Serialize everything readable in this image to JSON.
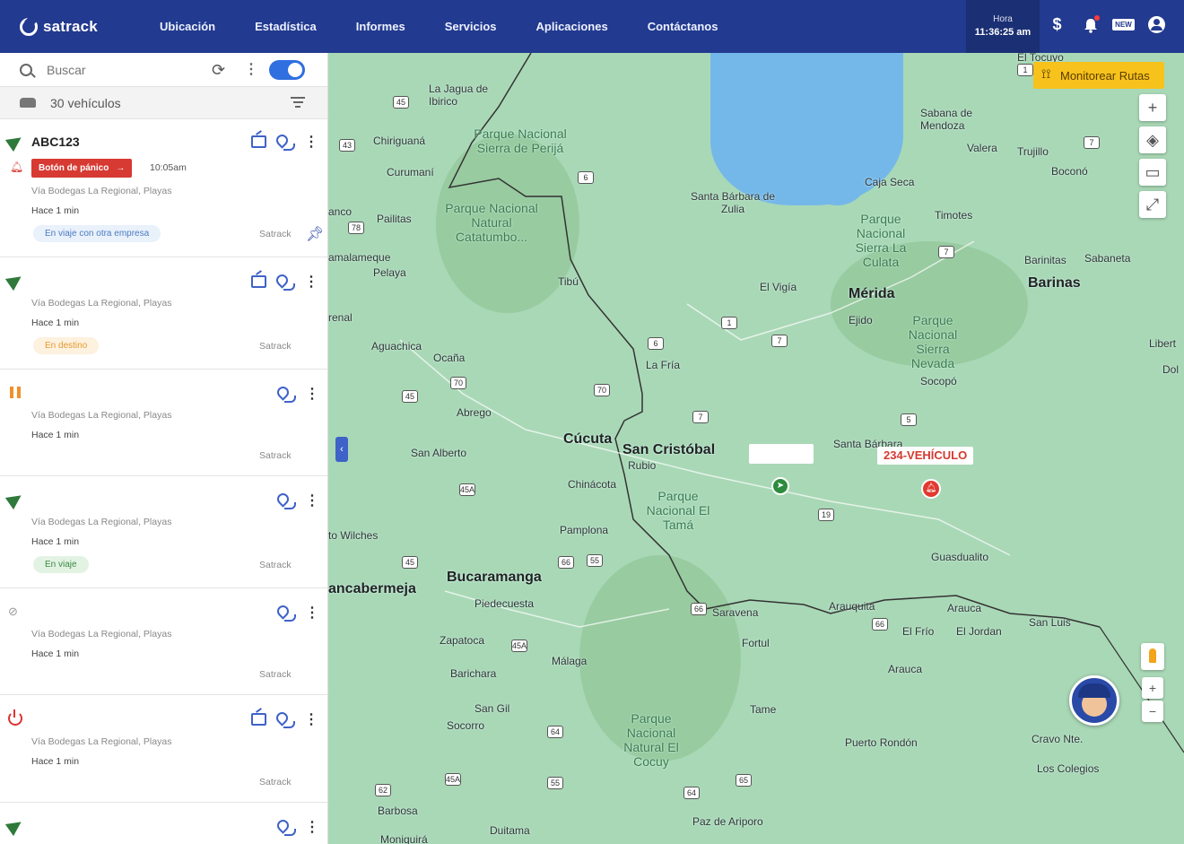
{
  "topbar": {
    "logo_text": "satrack",
    "nav": [
      "Ubicación",
      "Estadística",
      "Informes",
      "Servicios",
      "Aplicaciones",
      "Contáctanos"
    ],
    "clock_label": "Hora",
    "clock_value": "11:36:25 am",
    "icons": [
      "dollar-icon",
      "bell-icon",
      "new-icon",
      "user-icon"
    ],
    "new_badge": "NEW",
    "dollar": "$"
  },
  "sidebar": {
    "search_placeholder": "Buscar",
    "vehicle_count": "30 vehículos",
    "vehicles": [
      {
        "plate": "ABC123",
        "status_icon": "navigation-arrow-icon",
        "panic_label": "Botón de pánico",
        "panic_time": "10:05am",
        "address": "Vía Bodegas La Regional, Playas",
        "time": "Hace 1 min",
        "trip_status": "En viaje con otra empresa",
        "company": "Satrack",
        "pinned": true
      },
      {
        "plate": "",
        "status_icon": "navigation-arrow-icon",
        "address": "Vía Bodegas La Regional, Playas",
        "time": "Hace 1 min",
        "trip_status": "En destino",
        "company": "Satrack"
      },
      {
        "plate": "",
        "status_icon": "pause-icon",
        "address": "Vía Bodegas La Regional, Playas",
        "time": "Hace 1 min",
        "trip_status": "",
        "company": "Satrack"
      },
      {
        "plate": "",
        "status_icon": "navigation-arrow-icon",
        "address": "Vía Bodegas La Regional, Playas",
        "time": "Hace 1 min",
        "trip_status": "En viaje",
        "company": "Satrack"
      },
      {
        "plate": "",
        "status_icon": "no-signal-icon",
        "address": "Vía Bodegas La Regional, Playas",
        "time": "Hace 1 min",
        "trip_status": "",
        "company": "Satrack"
      },
      {
        "plate": "",
        "status_icon": "power-icon",
        "address": "Vía Bodegas La Regional, Playas",
        "time": "Hace 1 min",
        "trip_status": "",
        "company": "Satrack"
      }
    ]
  },
  "map": {
    "monitor_button": "Monitorear Rutas",
    "vehicle_label": "234-VEHÍCULO",
    "zoom_in": "+",
    "zoom_out": "−",
    "places": [
      "El Tocuyo",
      "La Jagua de Ibirico",
      "Chiriguaná",
      "Curumaní",
      "Parque Nacional Sierra de Perijá",
      "Pailitas",
      "Parque Nacional Natural Catatumbo...",
      "Tibú",
      "Santa Bárbara de Zulia",
      "Sabana de Mendoza",
      "Valera",
      "Trujillo",
      "Boconó",
      "Caja Seca",
      "Timotes",
      "Parque Nacional Sierra La Culata",
      "Barinitas",
      "Sabaneta",
      "Barinas",
      "Mérida",
      "Ejido",
      "El Vigía",
      "Parque Nacional Sierra Nevada",
      "Socopó",
      "Aguachica",
      "Ocaña",
      "Abrego",
      "La Fría",
      "Cúcuta",
      "San Cristóbal",
      "Rubio",
      "San Alberto",
      "Chinácota",
      "Parque Nacional El Tamá",
      "Pamplona",
      "Santa Bárbara",
      "Guasdualito",
      "Bucaramanga",
      "Piedecuesta",
      "Saravena",
      "Arauquita",
      "Arauca",
      "El Frío",
      "El Jordan",
      "San Luis",
      "Fortul",
      "Zapatoca",
      "Málaga",
      "Barichara",
      "San Gil",
      "Socorro",
      "Arauca",
      "Tame",
      "Parque Nacional Natural El Cocuy",
      "Puerto Rondón",
      "Cravo Nte.",
      "Los Colegios",
      "Barbosa",
      "Duitama",
      "Paz de Ariporo",
      "Moniquirá",
      "to Wilches",
      "ancabermeja",
      "amalameque",
      "Pelaya",
      "renal",
      "anco",
      "Libert",
      "Dol"
    ]
  }
}
